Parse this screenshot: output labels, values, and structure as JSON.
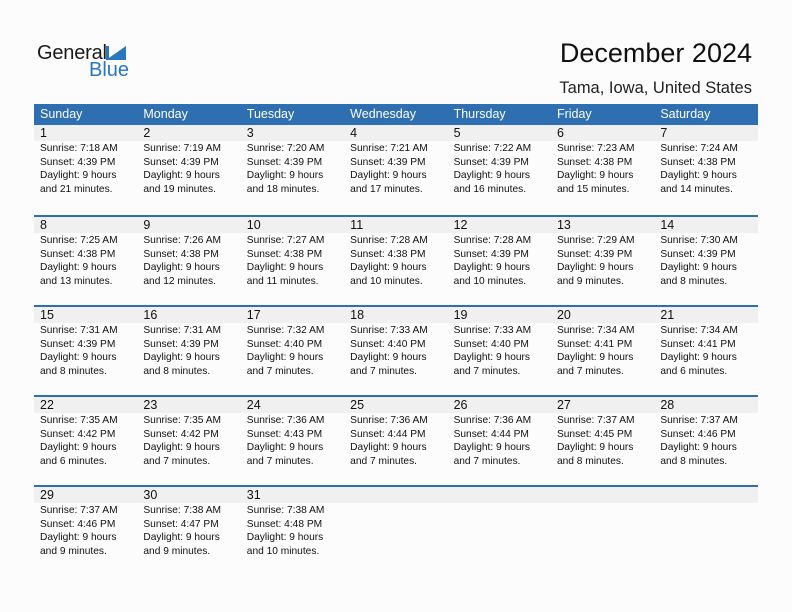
{
  "logo": {
    "word1": "General",
    "word2": "Blue",
    "icon": "triangle-flag-icon",
    "accent": "#2a77bd"
  },
  "header": {
    "title": "December 2024",
    "location": "Tama, Iowa, United States"
  },
  "colors": {
    "header_bg": "#2d6fb0",
    "daynum_bg": "#f0f0f0"
  },
  "weekdays": [
    "Sunday",
    "Monday",
    "Tuesday",
    "Wednesday",
    "Thursday",
    "Friday",
    "Saturday"
  ],
  "weeks": [
    [
      {
        "day": "1",
        "sunrise": "Sunrise: 7:18 AM",
        "sunset": "Sunset: 4:39 PM",
        "daylight1": "Daylight: 9 hours",
        "daylight2": "and 21 minutes."
      },
      {
        "day": "2",
        "sunrise": "Sunrise: 7:19 AM",
        "sunset": "Sunset: 4:39 PM",
        "daylight1": "Daylight: 9 hours",
        "daylight2": "and 19 minutes."
      },
      {
        "day": "3",
        "sunrise": "Sunrise: 7:20 AM",
        "sunset": "Sunset: 4:39 PM",
        "daylight1": "Daylight: 9 hours",
        "daylight2": "and 18 minutes."
      },
      {
        "day": "4",
        "sunrise": "Sunrise: 7:21 AM",
        "sunset": "Sunset: 4:39 PM",
        "daylight1": "Daylight: 9 hours",
        "daylight2": "and 17 minutes."
      },
      {
        "day": "5",
        "sunrise": "Sunrise: 7:22 AM",
        "sunset": "Sunset: 4:39 PM",
        "daylight1": "Daylight: 9 hours",
        "daylight2": "and 16 minutes."
      },
      {
        "day": "6",
        "sunrise": "Sunrise: 7:23 AM",
        "sunset": "Sunset: 4:38 PM",
        "daylight1": "Daylight: 9 hours",
        "daylight2": "and 15 minutes."
      },
      {
        "day": "7",
        "sunrise": "Sunrise: 7:24 AM",
        "sunset": "Sunset: 4:38 PM",
        "daylight1": "Daylight: 9 hours",
        "daylight2": "and 14 minutes."
      }
    ],
    [
      {
        "day": "8",
        "sunrise": "Sunrise: 7:25 AM",
        "sunset": "Sunset: 4:38 PM",
        "daylight1": "Daylight: 9 hours",
        "daylight2": "and 13 minutes."
      },
      {
        "day": "9",
        "sunrise": "Sunrise: 7:26 AM",
        "sunset": "Sunset: 4:38 PM",
        "daylight1": "Daylight: 9 hours",
        "daylight2": "and 12 minutes."
      },
      {
        "day": "10",
        "sunrise": "Sunrise: 7:27 AM",
        "sunset": "Sunset: 4:38 PM",
        "daylight1": "Daylight: 9 hours",
        "daylight2": "and 11 minutes."
      },
      {
        "day": "11",
        "sunrise": "Sunrise: 7:28 AM",
        "sunset": "Sunset: 4:38 PM",
        "daylight1": "Daylight: 9 hours",
        "daylight2": "and 10 minutes."
      },
      {
        "day": "12",
        "sunrise": "Sunrise: 7:28 AM",
        "sunset": "Sunset: 4:39 PM",
        "daylight1": "Daylight: 9 hours",
        "daylight2": "and 10 minutes."
      },
      {
        "day": "13",
        "sunrise": "Sunrise: 7:29 AM",
        "sunset": "Sunset: 4:39 PM",
        "daylight1": "Daylight: 9 hours",
        "daylight2": "and 9 minutes."
      },
      {
        "day": "14",
        "sunrise": "Sunrise: 7:30 AM",
        "sunset": "Sunset: 4:39 PM",
        "daylight1": "Daylight: 9 hours",
        "daylight2": "and 8 minutes."
      }
    ],
    [
      {
        "day": "15",
        "sunrise": "Sunrise: 7:31 AM",
        "sunset": "Sunset: 4:39 PM",
        "daylight1": "Daylight: 9 hours",
        "daylight2": "and 8 minutes."
      },
      {
        "day": "16",
        "sunrise": "Sunrise: 7:31 AM",
        "sunset": "Sunset: 4:39 PM",
        "daylight1": "Daylight: 9 hours",
        "daylight2": "and 8 minutes."
      },
      {
        "day": "17",
        "sunrise": "Sunrise: 7:32 AM",
        "sunset": "Sunset: 4:40 PM",
        "daylight1": "Daylight: 9 hours",
        "daylight2": "and 7 minutes."
      },
      {
        "day": "18",
        "sunrise": "Sunrise: 7:33 AM",
        "sunset": "Sunset: 4:40 PM",
        "daylight1": "Daylight: 9 hours",
        "daylight2": "and 7 minutes."
      },
      {
        "day": "19",
        "sunrise": "Sunrise: 7:33 AM",
        "sunset": "Sunset: 4:40 PM",
        "daylight1": "Daylight: 9 hours",
        "daylight2": "and 7 minutes."
      },
      {
        "day": "20",
        "sunrise": "Sunrise: 7:34 AM",
        "sunset": "Sunset: 4:41 PM",
        "daylight1": "Daylight: 9 hours",
        "daylight2": "and 7 minutes."
      },
      {
        "day": "21",
        "sunrise": "Sunrise: 7:34 AM",
        "sunset": "Sunset: 4:41 PM",
        "daylight1": "Daylight: 9 hours",
        "daylight2": "and 6 minutes."
      }
    ],
    [
      {
        "day": "22",
        "sunrise": "Sunrise: 7:35 AM",
        "sunset": "Sunset: 4:42 PM",
        "daylight1": "Daylight: 9 hours",
        "daylight2": "and 6 minutes."
      },
      {
        "day": "23",
        "sunrise": "Sunrise: 7:35 AM",
        "sunset": "Sunset: 4:42 PM",
        "daylight1": "Daylight: 9 hours",
        "daylight2": "and 7 minutes."
      },
      {
        "day": "24",
        "sunrise": "Sunrise: 7:36 AM",
        "sunset": "Sunset: 4:43 PM",
        "daylight1": "Daylight: 9 hours",
        "daylight2": "and 7 minutes."
      },
      {
        "day": "25",
        "sunrise": "Sunrise: 7:36 AM",
        "sunset": "Sunset: 4:44 PM",
        "daylight1": "Daylight: 9 hours",
        "daylight2": "and 7 minutes."
      },
      {
        "day": "26",
        "sunrise": "Sunrise: 7:36 AM",
        "sunset": "Sunset: 4:44 PM",
        "daylight1": "Daylight: 9 hours",
        "daylight2": "and 7 minutes."
      },
      {
        "day": "27",
        "sunrise": "Sunrise: 7:37 AM",
        "sunset": "Sunset: 4:45 PM",
        "daylight1": "Daylight: 9 hours",
        "daylight2": "and 8 minutes."
      },
      {
        "day": "28",
        "sunrise": "Sunrise: 7:37 AM",
        "sunset": "Sunset: 4:46 PM",
        "daylight1": "Daylight: 9 hours",
        "daylight2": "and 8 minutes."
      }
    ],
    [
      {
        "day": "29",
        "sunrise": "Sunrise: 7:37 AM",
        "sunset": "Sunset: 4:46 PM",
        "daylight1": "Daylight: 9 hours",
        "daylight2": "and 9 minutes."
      },
      {
        "day": "30",
        "sunrise": "Sunrise: 7:38 AM",
        "sunset": "Sunset: 4:47 PM",
        "daylight1": "Daylight: 9 hours",
        "daylight2": "and 9 minutes."
      },
      {
        "day": "31",
        "sunrise": "Sunrise: 7:38 AM",
        "sunset": "Sunset: 4:48 PM",
        "daylight1": "Daylight: 9 hours",
        "daylight2": "and 10 minutes."
      },
      {
        "day": "",
        "sunrise": "",
        "sunset": "",
        "daylight1": "",
        "daylight2": ""
      },
      {
        "day": "",
        "sunrise": "",
        "sunset": "",
        "daylight1": "",
        "daylight2": ""
      },
      {
        "day": "",
        "sunrise": "",
        "sunset": "",
        "daylight1": "",
        "daylight2": ""
      },
      {
        "day": "",
        "sunrise": "",
        "sunset": "",
        "daylight1": "",
        "daylight2": ""
      }
    ]
  ]
}
